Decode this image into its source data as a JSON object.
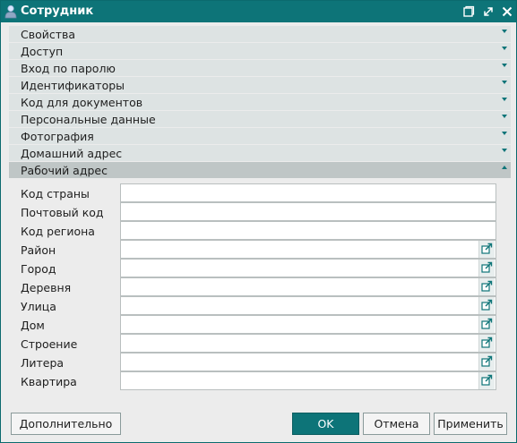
{
  "window": {
    "title": "Сотрудник"
  },
  "sections": [
    {
      "label": "Свойства",
      "expanded": false
    },
    {
      "label": "Доступ",
      "expanded": false
    },
    {
      "label": "Вход по паролю",
      "expanded": false
    },
    {
      "label": "Идентификаторы",
      "expanded": false
    },
    {
      "label": "Код для документов",
      "expanded": false
    },
    {
      "label": "Персональные данные",
      "expanded": false
    },
    {
      "label": "Фотография",
      "expanded": false
    },
    {
      "label": "Домашний адрес",
      "expanded": false
    },
    {
      "label": "Рабочий адрес",
      "expanded": true
    }
  ],
  "work_address": {
    "fields": [
      {
        "label": "Код страны",
        "value": "",
        "picker": false
      },
      {
        "label": "Почтовый код",
        "value": "",
        "picker": false
      },
      {
        "label": "Код региона",
        "value": "",
        "picker": false
      },
      {
        "label": "Район",
        "value": "",
        "picker": true
      },
      {
        "label": "Город",
        "value": "",
        "picker": true
      },
      {
        "label": "Деревня",
        "value": "",
        "picker": true
      },
      {
        "label": "Улица",
        "value": "",
        "picker": true
      },
      {
        "label": "Дом",
        "value": "",
        "picker": true
      },
      {
        "label": "Строение",
        "value": "",
        "picker": true
      },
      {
        "label": "Литера",
        "value": "",
        "picker": true
      },
      {
        "label": "Квартира",
        "value": "",
        "picker": true
      }
    ]
  },
  "footer": {
    "more_label": "Дополнительно",
    "ok_label": "OK",
    "cancel_label": "Отмена",
    "apply_label": "Применить"
  },
  "colors": {
    "accent": "#0d7478",
    "section_bg": "#dde3e3",
    "window_bg": "#ececec"
  }
}
